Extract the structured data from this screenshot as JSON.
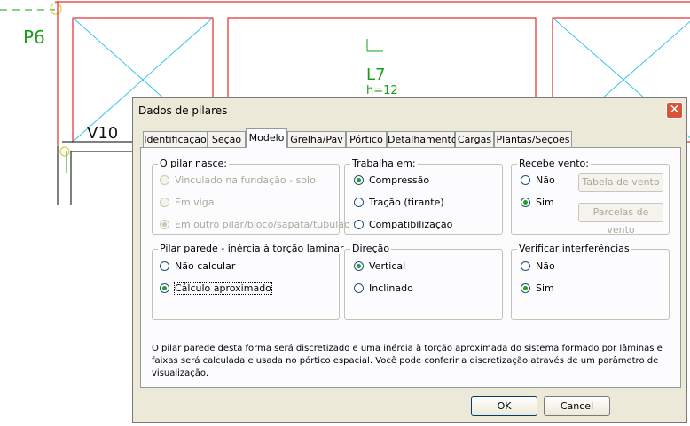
{
  "cad": {
    "labels": [
      "P6",
      "L7",
      "h=12",
      "V10"
    ]
  },
  "dialog": {
    "title": "Dados de pilares",
    "close_label": "✕",
    "tabs": [
      "Identificação",
      "Seção",
      "Modelo",
      "Grelha/Pav",
      "Pórtico",
      "Detalhamento",
      "Cargas",
      "Plantas/Seções"
    ],
    "active_tab": "Modelo",
    "groups": {
      "pilar_nasce": {
        "title": "O pilar nasce:",
        "options": [
          "Vinculado na fundação - solo",
          "Em viga",
          "Em outro pilar/bloco/sapata/tubulão"
        ],
        "selected": "Em outro pilar/bloco/sapata/tubulão"
      },
      "trabalha_em": {
        "title": "Trabalha em:",
        "options": [
          "Compressão",
          "Tração (tirante)",
          "Compatibilização"
        ],
        "selected": "Compressão"
      },
      "recebe_vento": {
        "title": "Recebe vento:",
        "options": [
          "Não",
          "Sim"
        ],
        "selected": "Sim",
        "buttons": [
          "Tabela de vento",
          "Parcelas de vento"
        ]
      },
      "pilar_parede": {
        "title": "Pilar parede - inércia à torção laminar",
        "options": [
          "Não calcular",
          "Cálculo aproximado"
        ],
        "selected": "Cálculo aproximado"
      },
      "direcao": {
        "title": "Direção",
        "options": [
          "Vertical",
          "Inclinado"
        ],
        "selected": "Vertical"
      },
      "verificar_interferencias": {
        "title": "Verificar interferências",
        "options": [
          "Não",
          "Sim"
        ],
        "selected": "Sim"
      }
    },
    "info_text": "O pilar parede desta forma será discretizado e uma inércia à torção aproximada do sistema formado por lâminas e faixas será calculada e usada no pórtico espacial. Você pode conferir a discretização através de um parâmetro de visualização.",
    "ok_label": "OK",
    "cancel_label": "Cancel"
  },
  "colors": {
    "cad_beam": "#e00000",
    "cad_slab_cross": "#33c3e8",
    "cad_text": "#1a9e1a",
    "dialog_bg": "#ece9d8",
    "radio_dot": "#21a121",
    "close_button": "#d9543a"
  }
}
